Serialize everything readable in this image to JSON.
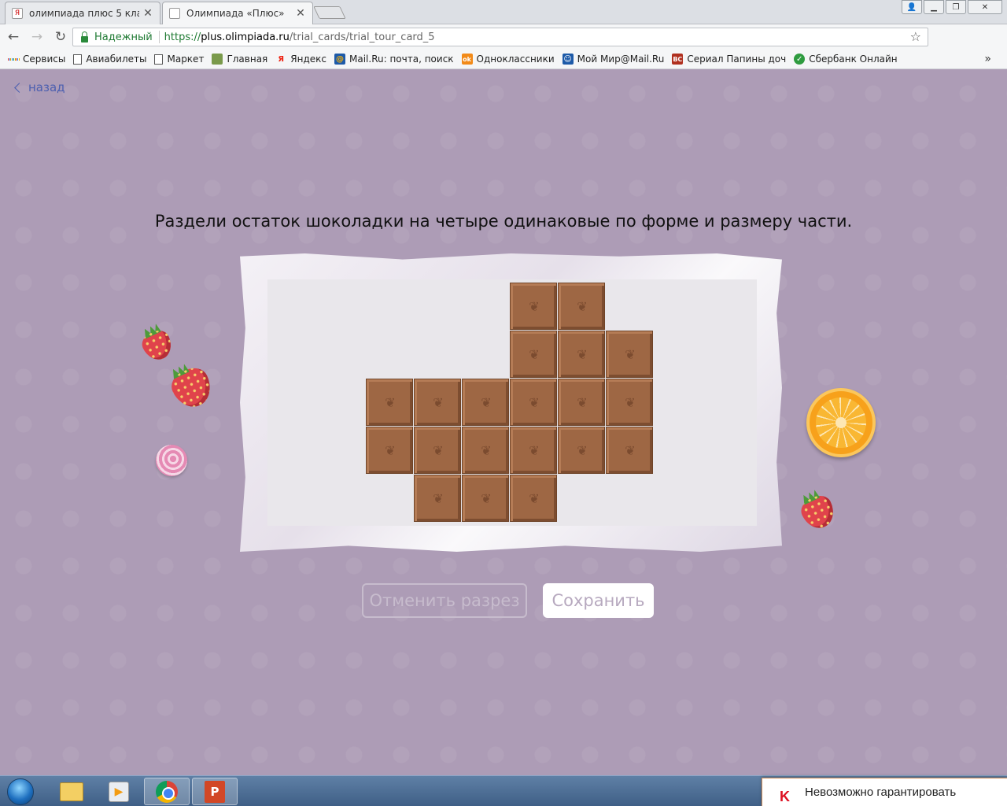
{
  "browser": {
    "tabs": [
      {
        "title": "олимпиада плюс 5 клас",
        "favicon": "Я"
      },
      {
        "title": "Олимпиада «Плюс»",
        "favicon": ""
      }
    ],
    "close_glyph": "✕",
    "address": {
      "security_label": "Надежный",
      "url_scheme": "https://",
      "url_host": "plus.olimpiada.ru",
      "url_path": "/trial_cards/trial_tour_card_5"
    },
    "extension_label": "Я",
    "bookmarks": [
      {
        "label": "Сервисы",
        "icon": "apps-grid-icon"
      },
      {
        "label": "Авиабилеты",
        "icon": "page-icon"
      },
      {
        "label": "Маркет",
        "icon": "page-icon"
      },
      {
        "label": "Главная",
        "icon": "site-icon"
      },
      {
        "label": "Яндекс",
        "icon": "yandex-icon",
        "glyph": "Я"
      },
      {
        "label": "Mail.Ru: почта, поиск",
        "icon": "mailru-icon",
        "glyph": "@"
      },
      {
        "label": "Одноклассники",
        "icon": "odnoklassniki-icon",
        "glyph": "ok"
      },
      {
        "label": "Мой Мир@Mail.Ru",
        "icon": "moymir-icon",
        "glyph": "☺"
      },
      {
        "label": "Сериал Папины доч",
        "icon": "vk-icon",
        "glyph": "ВС"
      },
      {
        "label": "Сбербанк Онлайн",
        "icon": "sberbank-icon",
        "glyph": "✓"
      }
    ],
    "more_glyph": "»"
  },
  "page": {
    "back_label": "назад",
    "task_text": "Раздели остаток шоколадки на четыре одинаковые по форме и размеру части.",
    "chocolate": {
      "cols": 6,
      "rows": 5,
      "pieces": [
        [
          0,
          3
        ],
        [
          0,
          4
        ],
        [
          1,
          3
        ],
        [
          1,
          4
        ],
        [
          1,
          5
        ],
        [
          2,
          0
        ],
        [
          2,
          1
        ],
        [
          2,
          2
        ],
        [
          2,
          3
        ],
        [
          2,
          4
        ],
        [
          2,
          5
        ],
        [
          3,
          0
        ],
        [
          3,
          1
        ],
        [
          3,
          2
        ],
        [
          3,
          3
        ],
        [
          3,
          4
        ],
        [
          3,
          5
        ],
        [
          4,
          1
        ],
        [
          4,
          2
        ],
        [
          4,
          3
        ]
      ]
    },
    "buttons": {
      "undo_label": "Отменить разрез",
      "save_label": "Сохранить"
    }
  },
  "taskbar": {
    "notification_text": "Невозможно гарантировать",
    "notification_glyph": "K"
  },
  "colors": {
    "page_background": "#ad9cb6",
    "chocolate": "#9e6744",
    "link": "#4b5fb0",
    "secure_green": "#1f7a33"
  }
}
